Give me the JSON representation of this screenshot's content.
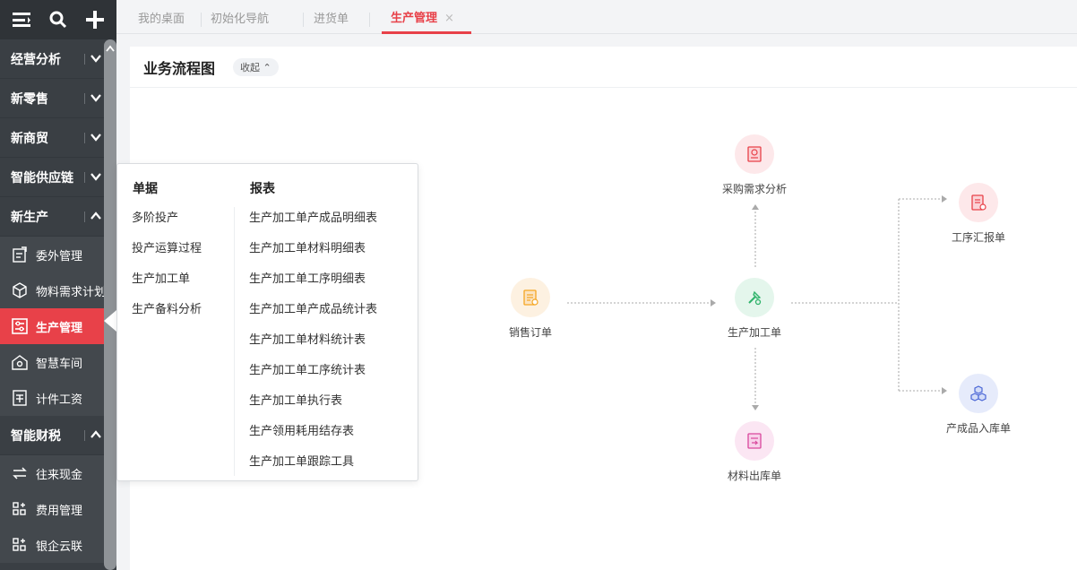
{
  "sidebar": {
    "toolbar": {
      "menu_icon": "menu-icon",
      "search_icon": "search-icon",
      "add_icon": "plus-icon"
    },
    "sections": [
      {
        "label": "经营分析",
        "expanded": false
      },
      {
        "label": "新零售",
        "expanded": false
      },
      {
        "label": "新商贸",
        "expanded": false
      },
      {
        "label": "智能供应链",
        "expanded": false
      },
      {
        "label": "新生产",
        "expanded": true
      },
      {
        "label": "智能财税",
        "expanded": true
      }
    ],
    "items_production": [
      {
        "label": "委外管理",
        "icon": "outsourcing-icon"
      },
      {
        "label": "物料需求计划",
        "icon": "cube-icon"
      },
      {
        "label": "生产管理",
        "icon": "production-icon",
        "active": true
      },
      {
        "label": "智慧车间",
        "icon": "workshop-icon"
      },
      {
        "label": "计件工资",
        "icon": "piecework-icon"
      }
    ],
    "items_finance": [
      {
        "label": "往来现金",
        "icon": "exchange-icon"
      },
      {
        "label": "费用管理",
        "icon": "expense-icon"
      },
      {
        "label": "银企云联",
        "icon": "bank-icon"
      }
    ]
  },
  "tabs": [
    {
      "label": "我的桌面"
    },
    {
      "label": "初始化导航"
    },
    {
      "label": "进货单"
    },
    {
      "label": "生产管理",
      "active": true,
      "close": "×"
    }
  ],
  "panel": {
    "title": "业务流程图",
    "collapse_label": "收起 ⌃"
  },
  "flow": {
    "sales_order": "销售订单",
    "purchase_analysis": "采购需求分析",
    "production_order": "生产加工单",
    "process_report": "工序汇报单",
    "material_out": "材料出库单",
    "finished_in": "产成品入库单"
  },
  "popup": {
    "documents_title": "单据",
    "reports_title": "报表",
    "documents": [
      "多阶投产",
      "投产运算过程",
      "生产加工单",
      "生产备料分析"
    ],
    "reports": [
      "生产加工单产成品明细表",
      "生产加工单材料明细表",
      "生产加工单工序明细表",
      "生产加工单产成品统计表",
      "生产加工单材料统计表",
      "生产加工单工序统计表",
      "生产加工单执行表",
      "生产领用耗用结存表",
      "生产加工单跟踪工具"
    ]
  },
  "colors": {
    "accent": "#e84149",
    "sidebar": "#3a3f44"
  }
}
